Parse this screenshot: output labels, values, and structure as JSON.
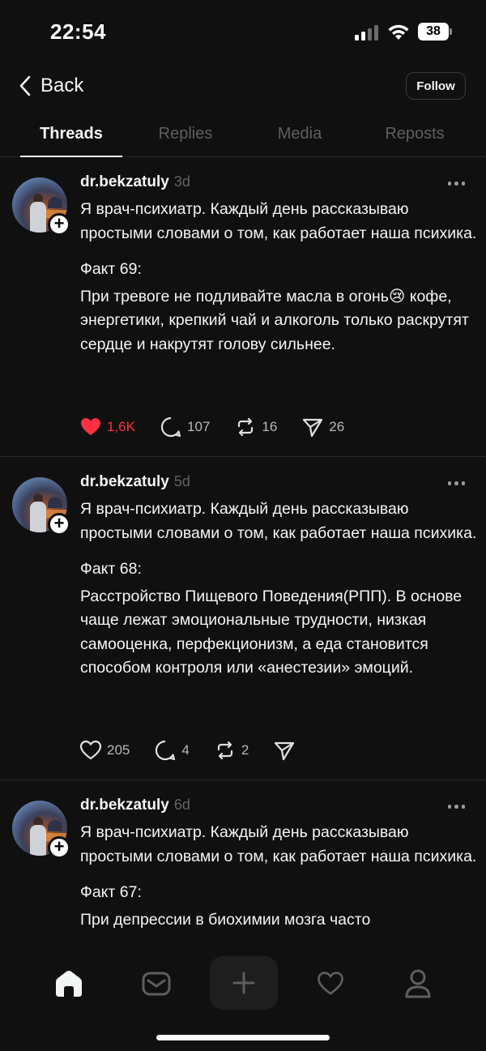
{
  "status_bar": {
    "time": "22:54",
    "battery": "38",
    "icons": [
      "signal-icon",
      "wifi-icon",
      "battery-icon"
    ]
  },
  "header": {
    "back_label": "Back",
    "follow_label": "Follow"
  },
  "tabs": [
    {
      "label": "Threads",
      "active": true
    },
    {
      "label": "Replies",
      "active": false
    },
    {
      "label": "Media",
      "active": false
    },
    {
      "label": "Reposts",
      "active": false
    }
  ],
  "posts": [
    {
      "username": "dr.bekzatuly",
      "time": "3d",
      "paragraphs": [
        "Я  врач-психиатр. Каждый день рассказываю простыми словами о том, как работает наша психика.",
        "Факт 69:",
        "При тревоге не подливайте масла в огонь😢 кофе, энергетики, крепкий чай и алкоголь только раскрутят сердце и накрутят голову сильнее."
      ],
      "liked": true,
      "likes": "1,6K",
      "replies": "107",
      "reposts": "16",
      "shares": "26"
    },
    {
      "username": "dr.bekzatuly",
      "time": "5d",
      "paragraphs": [
        "Я  врач-психиатр. Каждый день рассказываю простыми словами о том, как работает наша психика.",
        "Факт 68:",
        "Расстройство Пищевого Поведения(РПП). В основе чаще лежат эмоциональные трудности, низкая самооценка, перфекционизм, а еда становится способом контроля или «анестезии» эмоций."
      ],
      "liked": false,
      "likes": "205",
      "replies": "4",
      "reposts": "2",
      "shares": ""
    },
    {
      "username": "dr.bekzatuly",
      "time": "6d",
      "paragraphs": [
        "Я  врач-психиатр. Каждый день рассказываю простыми словами о том, как работает наша психика.",
        "Факт 67:",
        "При депрессии в биохимии мозга часто"
      ]
    }
  ],
  "bottom_nav": [
    "home-icon",
    "inbox-icon",
    "plus-icon",
    "heart-icon",
    "profile-icon"
  ],
  "colors": {
    "background": "#101010",
    "text": "#f3f5f7",
    "muted": "#616161",
    "like_red": "#ff3040"
  }
}
